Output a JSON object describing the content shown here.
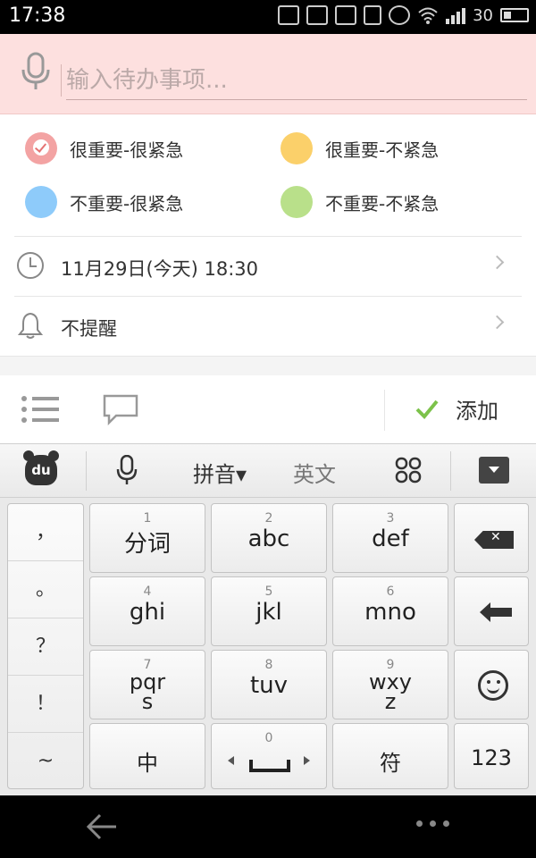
{
  "status_bar": {
    "time": "17:38",
    "battery_level": "30",
    "icons": [
      "app-grid-icon",
      "keyboard-icon",
      "image-icon",
      "vibrate-icon",
      "alarm-icon",
      "wifi-icon",
      "signal-icon",
      "battery-icon"
    ]
  },
  "input": {
    "placeholder": "输入待办事项...",
    "value": ""
  },
  "priority": {
    "options": [
      {
        "label": "很重要-很紧急",
        "color": "#f3a3a3",
        "selected": true
      },
      {
        "label": "很重要-不紧急",
        "color": "#fbd06a",
        "selected": false
      },
      {
        "label": "不重要-很紧急",
        "color": "#8ecbfa",
        "selected": false
      },
      {
        "label": "不重要-不紧急",
        "color": "#b9e08a",
        "selected": false
      }
    ]
  },
  "datetime": {
    "label": "11月29日(今天) 18:30"
  },
  "reminder": {
    "label": "不提醒"
  },
  "actions": {
    "add_label": "添加",
    "accent": "#7cc24a"
  },
  "keyboard": {
    "toolbar": {
      "logo": "du",
      "pinyin": "拼音▾",
      "english": "英文"
    },
    "symbols": [
      "，",
      "。",
      "？",
      "！",
      "~"
    ],
    "keys": {
      "k1": {
        "num": "1",
        "label": "分词"
      },
      "k2": {
        "num": "2",
        "label": "abc"
      },
      "k3": {
        "num": "3",
        "label": "def"
      },
      "k4": {
        "num": "4",
        "label": "ghi"
      },
      "k5": {
        "num": "5",
        "label": "jkl"
      },
      "k6": {
        "num": "6",
        "label": "mno"
      },
      "k7": {
        "num": "7",
        "label": "pqr",
        "label2": "s"
      },
      "k8": {
        "num": "8",
        "label": "tuv"
      },
      "k9": {
        "num": "9",
        "label": "wxy",
        "label2": "z"
      },
      "zhong": {
        "label": "中"
      },
      "space": {
        "num": "0"
      },
      "fu": {
        "label": "符"
      },
      "num123": {
        "label": "123"
      }
    }
  }
}
